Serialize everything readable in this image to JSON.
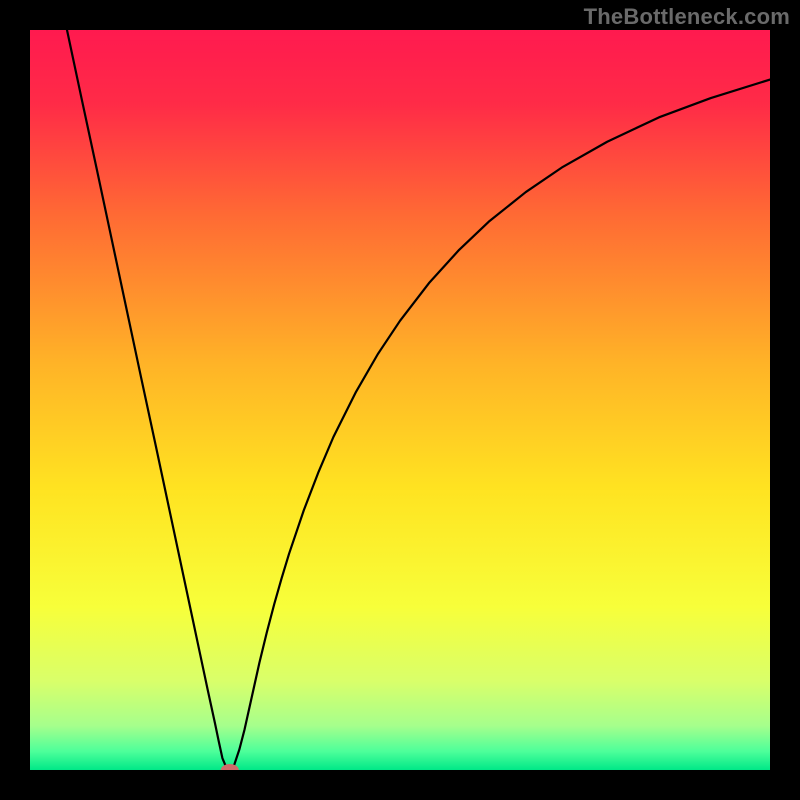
{
  "watermark": "TheBottleneck.com",
  "chart_data": {
    "type": "line",
    "title": "",
    "xlabel": "",
    "ylabel": "",
    "xlim": [
      0,
      100
    ],
    "ylim": [
      0,
      100
    ],
    "background_gradient": {
      "stops": [
        {
          "offset": 0.0,
          "color": "#ff1a4f"
        },
        {
          "offset": 0.1,
          "color": "#ff2b47"
        },
        {
          "offset": 0.25,
          "color": "#ff6a34"
        },
        {
          "offset": 0.45,
          "color": "#ffb327"
        },
        {
          "offset": 0.62,
          "color": "#ffe321"
        },
        {
          "offset": 0.78,
          "color": "#f7ff3a"
        },
        {
          "offset": 0.88,
          "color": "#d9ff6a"
        },
        {
          "offset": 0.94,
          "color": "#a6ff8c"
        },
        {
          "offset": 0.975,
          "color": "#4dff9a"
        },
        {
          "offset": 1.0,
          "color": "#00e888"
        }
      ]
    },
    "series": [
      {
        "name": "bottleneck-curve",
        "color": "#000000",
        "x": [
          5.0,
          7.0,
          9.0,
          11.0,
          13.0,
          15.0,
          17.0,
          19.0,
          20.0,
          21.0,
          22.0,
          23.0,
          24.0,
          25.0,
          25.5,
          26.0,
          26.5,
          27.0,
          27.6,
          28.3,
          29.0,
          30.0,
          31.0,
          32.0,
          33.0,
          34.0,
          35.0,
          37.0,
          39.0,
          41.0,
          44.0,
          47.0,
          50.0,
          54.0,
          58.0,
          62.0,
          67.0,
          72.0,
          78.0,
          85.0,
          92.0,
          100.0
        ],
        "y": [
          100.0,
          90.6,
          81.3,
          71.9,
          62.5,
          53.1,
          43.8,
          34.4,
          29.7,
          25.0,
          20.3,
          15.6,
          10.9,
          6.3,
          3.9,
          1.6,
          0.4,
          0.0,
          0.7,
          2.8,
          5.5,
          10.0,
          14.5,
          18.6,
          22.4,
          25.9,
          29.2,
          35.1,
          40.3,
          45.0,
          51.0,
          56.2,
          60.7,
          65.9,
          70.3,
          74.1,
          78.1,
          81.5,
          84.9,
          88.2,
          90.8,
          93.3
        ]
      }
    ],
    "marker": {
      "x": 27.0,
      "y": 0.0,
      "color": "#cf6a6a",
      "rx": 9,
      "ry": 6
    }
  }
}
